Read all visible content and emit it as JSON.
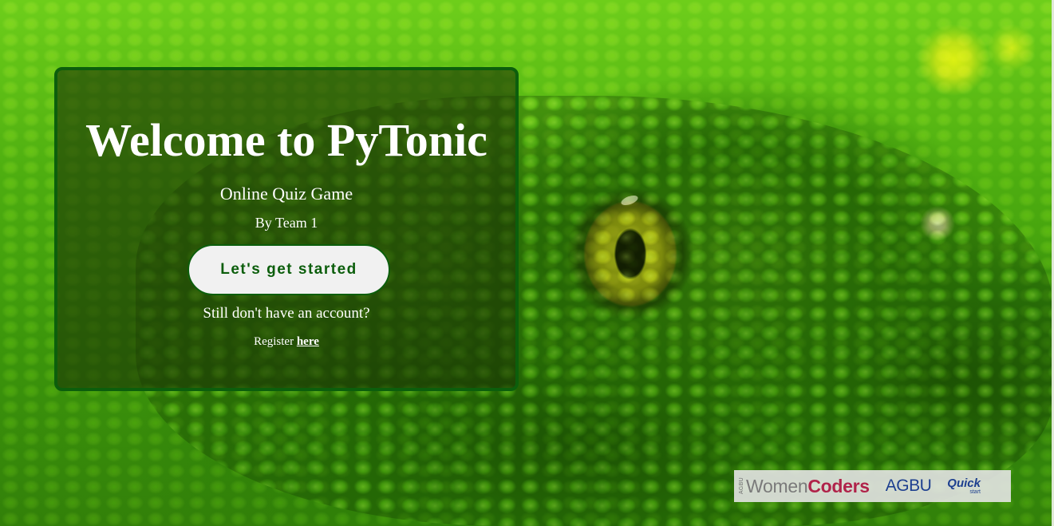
{
  "hero": {
    "title": "Welcome to PyTonic",
    "subtitle": "Online Quiz Game",
    "team": "By Team 1",
    "start_button": "Let's get started",
    "account_prompt": "Still don't have an account?",
    "register_prefix": "Register ",
    "register_link": "here"
  },
  "sponsors": {
    "tiny_label": "AGBU",
    "women": "Women",
    "coders": "Coders",
    "agbu": "AGBU",
    "quick": "Quick",
    "quick_sub": "start"
  },
  "colors": {
    "brand_green": "#0c5e0c",
    "button_bg": "#f1f1f1",
    "coders_red": "#b0234a",
    "agbu_blue": "#1d3f8f"
  }
}
